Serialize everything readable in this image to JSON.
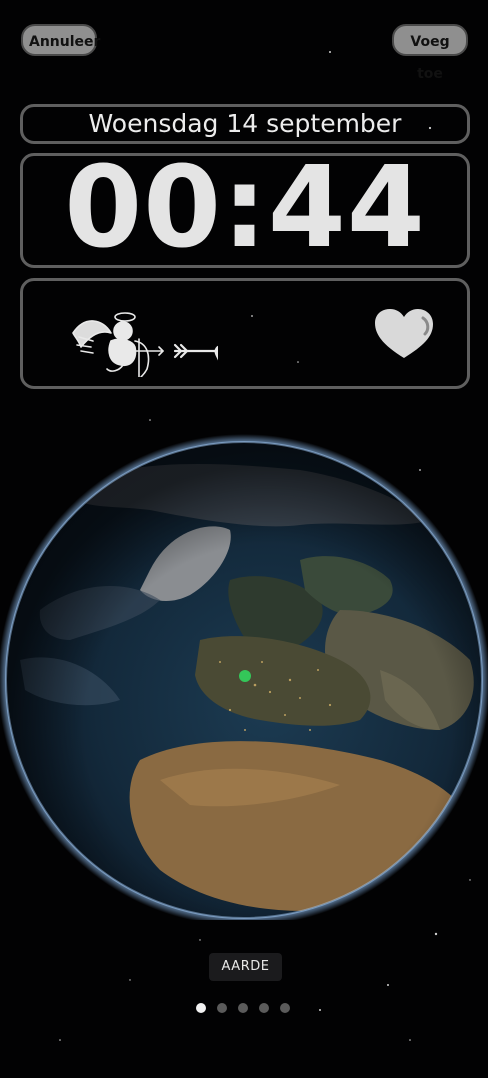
{
  "header": {
    "cancel_label": "Annuleer",
    "add_label": "Voeg toe"
  },
  "lockscreen": {
    "date": "Woensdag 14 september",
    "time": "00:44"
  },
  "widgets": {
    "left_icon": "cupid-icon",
    "right_icon": "heart-icon"
  },
  "wallpaper": {
    "name": "AARDE",
    "location_dot_color": "#34c759"
  },
  "pagination": {
    "count": 5,
    "active_index": 0
  },
  "colors": {
    "background": "#020203",
    "button": "#8f8f8f",
    "frame": "#5f5f5f",
    "text": "#ececec"
  }
}
